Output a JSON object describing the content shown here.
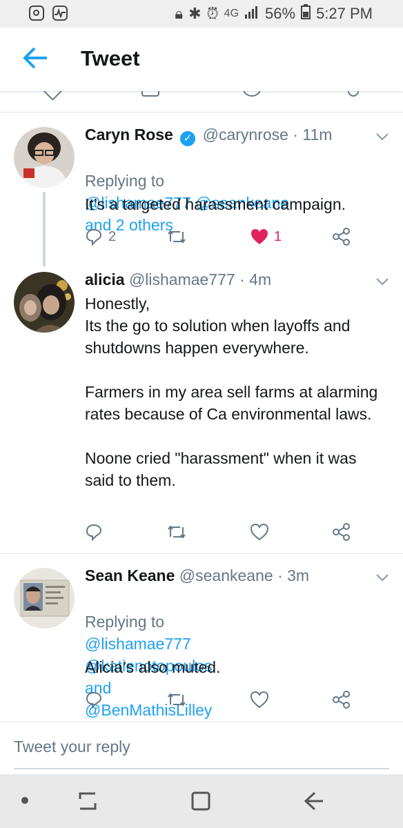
{
  "status_bar": {
    "battery": "56%",
    "time": "5:27 PM",
    "network": "4G"
  },
  "header": {
    "title": "Tweet"
  },
  "tweets": [
    {
      "name": "Caryn Rose",
      "verified": true,
      "handle": "@carynrose",
      "time": "· 11m",
      "replying_label": "Replying to",
      "replying_to": "@lishamae777 @seankeane",
      "replying_more": "and 2 others",
      "text": "It’s a targeted harassment campaign.",
      "reply_count": "2",
      "like_count": "1"
    },
    {
      "name": "alicia",
      "handle": "@lishamae777",
      "time": "· 4m",
      "text": "Honestly,\nIts the go to solution when layoffs and shutdowns happen everywhere.\n\nFarmers in my area sell farms at alarming rates because of Ca environmental laws.\n\nNoone cried \"harassment\" when it was said to them."
    },
    {
      "name": "Sean Keane",
      "handle": "@seankeane",
      "time": "· 3m",
      "replying_label": "Replying to",
      "replying_to_1": "@lishamae777",
      "replying_to_2": "@katienotopoulos",
      "replying_and": "and",
      "replying_to_3": "@BenMathisLilley",
      "text": "Alicia’s also muted."
    }
  ],
  "reply_box": {
    "placeholder": "Tweet your reply"
  },
  "colors": {
    "accent": "#1da1f2",
    "like": "#e0245e",
    "secondary_text": "#657786",
    "divider": "#e1e8ed"
  },
  "icons": [
    "back-arrow-icon",
    "chevron-down-icon",
    "reply-icon",
    "retweet-icon",
    "like-icon",
    "share-icon",
    "verified-badge-icon"
  ]
}
